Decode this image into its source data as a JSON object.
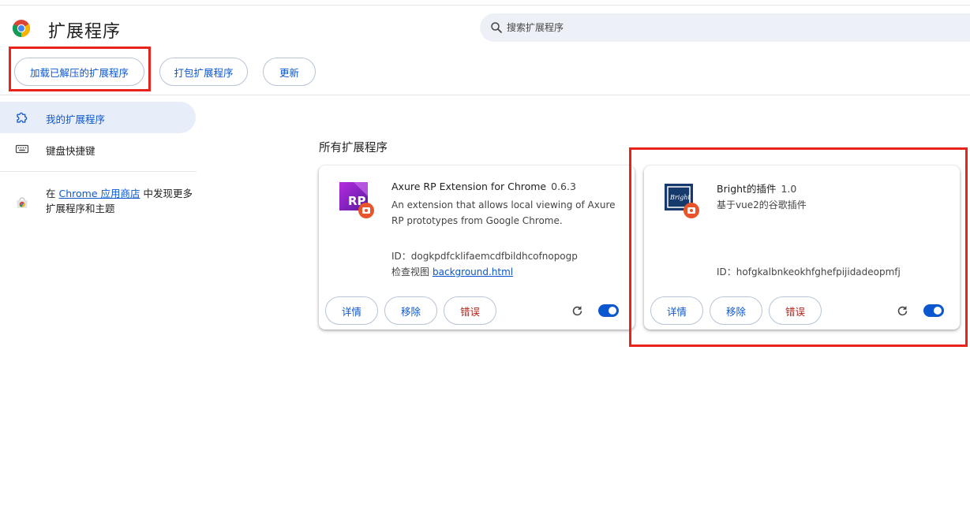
{
  "header": {
    "title": "扩展程序",
    "search_placeholder": "搜索扩展程序"
  },
  "toolbar": {
    "load_unpacked": "加载已解压的扩展程序",
    "pack": "打包扩展程序",
    "update": "更新"
  },
  "sidebar": {
    "items": [
      {
        "label": "我的扩展程序",
        "icon": "puzzle-icon",
        "active": true
      },
      {
        "label": "键盘快捷键",
        "icon": "keyboard-icon",
        "active": false
      }
    ],
    "store_prefix": "在 ",
    "store_link": "Chrome 应用商店",
    "store_suffix": " 中发现更多扩展程序和主题"
  },
  "main": {
    "section_title": "所有扩展程序",
    "extensions": [
      {
        "name": "Axure RP Extension for Chrome",
        "version": "0.6.3",
        "description": "An extension that allows local viewing of Axure RP prototypes from Google Chrome.",
        "id_line": "ID：dogkpdfcklifaemcdfbildhcofnopogp",
        "inspect_label": "检查视图",
        "inspect_link": "background.html",
        "details": "详情",
        "remove": "移除",
        "errors": "错误",
        "enabled": true
      },
      {
        "name": "Bright的插件",
        "version": "1.0",
        "description": "基于vue2的谷歌插件",
        "id_line": "ID：hofgkalbnkeokhfghefpijidadeopmfj",
        "details": "详情",
        "remove": "移除",
        "errors": "错误",
        "enabled": true
      }
    ]
  },
  "colors": {
    "accent": "#0b57d0",
    "error": "#b3261e",
    "highlight_box": "#e8231c",
    "sidebar_active_bg": "#e8eef9"
  }
}
